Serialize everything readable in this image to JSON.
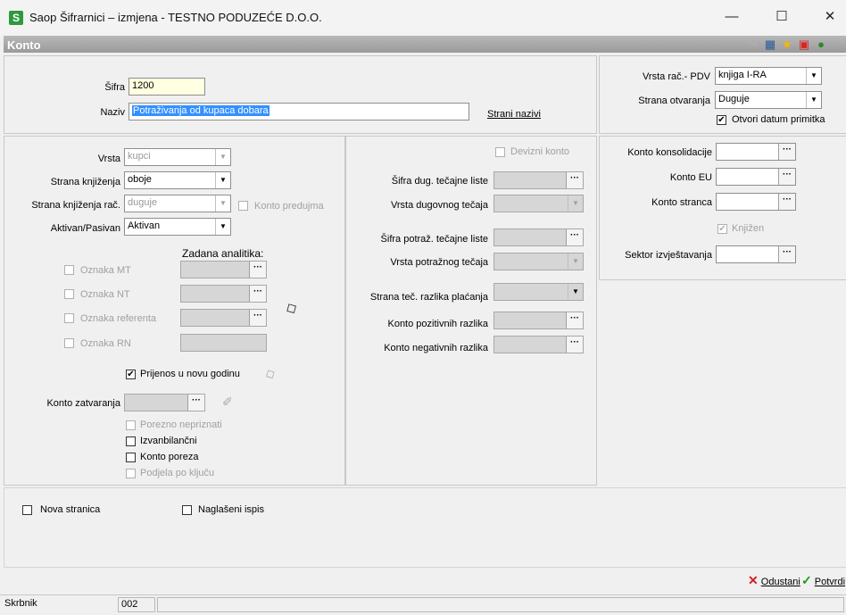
{
  "window": {
    "title": "Saop Šifrarnici – izmjena  - TESTNO PODUZEĆE D.O.O.",
    "app_icon": "S",
    "minimize": "—",
    "maximize": "☐",
    "close": "✕"
  },
  "form": {
    "title": "Konto",
    "toolbar_icons": [
      "edit-icon",
      "table-icon",
      "star-icon",
      "pdf-icon",
      "exit-icon"
    ]
  },
  "header": {
    "sifra_label": "Šifra",
    "sifra_value": "1200",
    "naziv_label": "Naziv",
    "naziv_value": "Potraživanja od kupaca dobara",
    "strani_nazivi": "Strani nazivi"
  },
  "right_top": {
    "vrsta_rac_pdv_label": "Vrsta rač.- PDV",
    "vrsta_rac_pdv_value": "knjiga I-RA",
    "strana_otvaranja_label": "Strana otvaranja",
    "strana_otvaranja_value": "Duguje",
    "otvori_datum_label": "Otvori datum primitka",
    "otvori_datum_checked": true
  },
  "left": {
    "vrsta_label": "Vrsta",
    "vrsta_value": "kupci",
    "strana_knjizenja_label": "Strana knjiženja",
    "strana_knjizenja_value": "oboje",
    "strana_knjizenja_rac_label": "Strana knjiženja rač.",
    "strana_knjizenja_rac_value": "duguje",
    "konto_predujma_label": "Konto predujma",
    "aktivan_pasivan_label": "Aktivan/Pasivan",
    "aktivan_pasivan_value": "Aktivan",
    "zadana_analitika_label": "Zadana analitika:",
    "oznaka_mt": "Oznaka MT",
    "oznaka_nt": "Oznaka NT",
    "oznaka_referenta": "Oznaka referenta",
    "oznaka_rn": "Oznaka RN",
    "prijenos_label": "Prijenos u novu godinu",
    "konto_zatvaranja_label": "Konto zatvaranja",
    "porezno_nepriznati": "Porezno nepriznati",
    "izvanbilancni": "Izvanbilančni",
    "konto_poreza": "Konto poreza",
    "podjela_po_kljucu": "Podjela po ključu"
  },
  "middle": {
    "devizni_konto": "Devizni konto",
    "sifra_dug_tecajne_liste": "Šifra dug. tečajne liste",
    "vrsta_dugovnog_tecaja": "Vrsta dugovnog tečaja",
    "sifra_potraz_tecajne_liste": "Šifra potraž. tečajne liste",
    "vrsta_potraznog_tecaja": "Vrsta potražnog tečaja",
    "strana_tec_razlika": "Strana teč. razlika plaćanja",
    "konto_pozitivnih_razlika": "Konto pozitivnih razlika",
    "konto_negativnih_razlika": "Konto negativnih razlika"
  },
  "right": {
    "konto_konsolidacije": "Konto konsolidacije",
    "konto_eu": "Konto EU",
    "konto_stranca": "Konto stranca",
    "knjizen": "Knjižen",
    "sektor_izvjestavanja": "Sektor izvještavanja"
  },
  "bottom": {
    "nova_stranica": "Nova stranica",
    "naglaseni_ispis": "Naglašeni ispis"
  },
  "actions": {
    "odustani": "Odustani",
    "potvrdi": "Potvrdi"
  },
  "status": {
    "user": "Skrbnik",
    "code": "002"
  },
  "common": {
    "dots": "···",
    "arrow": "▼",
    "check": "✔"
  }
}
